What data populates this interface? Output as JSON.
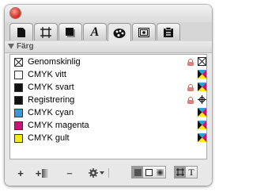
{
  "window": {
    "close_button": "close"
  },
  "tabs": [
    {
      "name": "tab-fill-stroke",
      "icon": "page-icon"
    },
    {
      "name": "tab-transform",
      "icon": "frame-icon"
    },
    {
      "name": "tab-shadow",
      "icon": "box-shadow-icon"
    },
    {
      "name": "tab-character",
      "icon": "italic-a-icon",
      "text": "A"
    },
    {
      "name": "tab-swatches",
      "icon": "palette-icon",
      "active": true
    },
    {
      "name": "tab-image",
      "icon": "image-icon"
    },
    {
      "name": "tab-paste",
      "icon": "clipboard-icon"
    }
  ],
  "section": {
    "title": "Färg"
  },
  "colors": [
    {
      "name": "Genomskinlig",
      "swatch": "none",
      "locked": true,
      "mode": "none"
    },
    {
      "name": "CMYK vitt",
      "swatch": "#ffffff",
      "locked": false,
      "mode": "cmyk"
    },
    {
      "name": "CMYK svart",
      "swatch": "#111111",
      "locked": true,
      "mode": "cmyk"
    },
    {
      "name": "Registrering",
      "swatch": "#111111",
      "locked": true,
      "mode": "registration"
    },
    {
      "name": "CMYK cyan",
      "swatch": "#2f9fd8",
      "locked": false,
      "mode": "cmyk"
    },
    {
      "name": "CMYK magenta",
      "swatch": "#c8137a",
      "locked": false,
      "mode": "cmyk"
    },
    {
      "name": "CMYK gult",
      "swatch": "#f5e90f",
      "locked": false,
      "mode": "cmyk"
    }
  ],
  "toolbar": {
    "add_label": "+",
    "add_from_doc_label": "+",
    "remove_label": "−",
    "text_mode_label": "T"
  }
}
